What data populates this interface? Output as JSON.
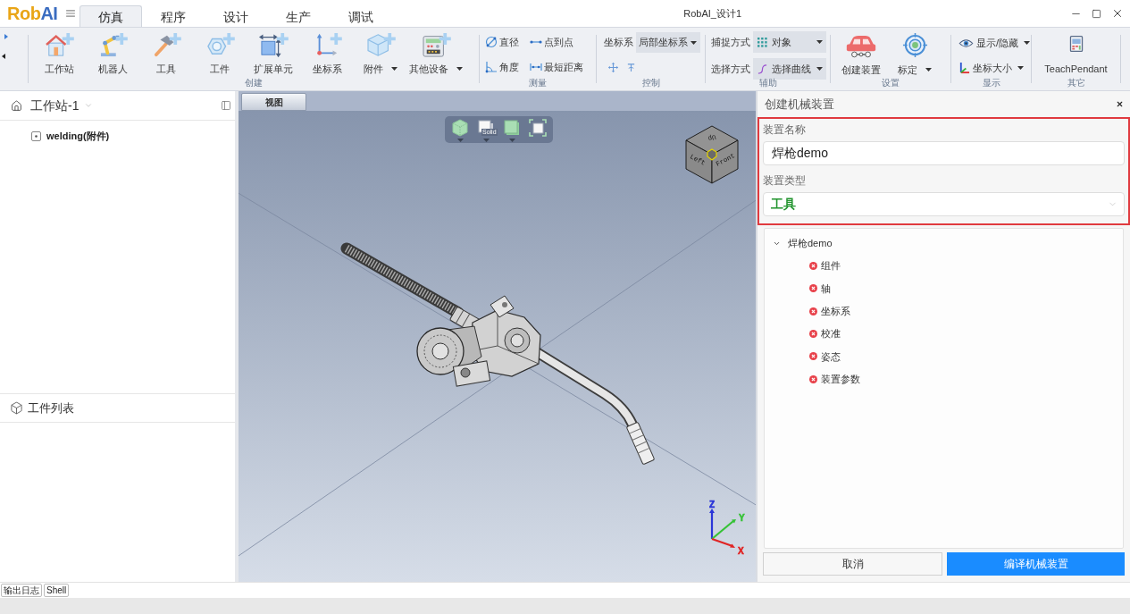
{
  "logo": {
    "text": "Rob",
    "accent": "AI"
  },
  "tabs": [
    {
      "label": "仿真",
      "selected": true
    },
    {
      "label": "程序",
      "selected": false
    },
    {
      "label": "设计",
      "selected": false
    },
    {
      "label": "生产",
      "selected": false
    },
    {
      "label": "调试",
      "selected": false
    }
  ],
  "window": {
    "title": "RobAI_设计1"
  },
  "ribbon": {
    "groups": [
      {
        "kind": "large",
        "label": "创建",
        "items": [
          {
            "label": "工作站",
            "dropdown": false
          },
          {
            "label": "机器人",
            "dropdown": false
          },
          {
            "label": "工具",
            "dropdown": false
          },
          {
            "label": "工件",
            "dropdown": false
          },
          {
            "label": "扩展单元",
            "dropdown": false
          },
          {
            "label": "坐标系",
            "dropdown": false
          },
          {
            "label": "附件",
            "dropdown": true
          },
          {
            "label": "其他设备",
            "dropdown": true
          }
        ]
      },
      {
        "kind": "grid",
        "label": "测量",
        "items": [
          {
            "label": "直径"
          },
          {
            "label": "点到点"
          },
          {
            "label": "角度"
          },
          {
            "label": "最短距离"
          }
        ]
      },
      {
        "kind": "control",
        "label": "控制",
        "fields": [
          {
            "label": "坐标系",
            "value": "局部坐标系"
          }
        ]
      },
      {
        "kind": "form",
        "label": "辅助",
        "fields": [
          {
            "label": "捕捉方式",
            "value": "对象"
          },
          {
            "label": "选择方式",
            "value": "选择曲线"
          }
        ]
      },
      {
        "kind": "large",
        "label": "设置",
        "items": [
          {
            "label": "创建装置",
            "dropdown": false
          },
          {
            "label": "标定",
            "dropdown": true
          }
        ]
      },
      {
        "kind": "list",
        "label": "显示",
        "items": [
          {
            "label": "显示/隐藏",
            "dropdown": true
          },
          {
            "label": "坐标大小",
            "dropdown": true
          }
        ]
      },
      {
        "kind": "large",
        "label": "其它",
        "items": [
          {
            "label": "TeachPendant",
            "dropdown": false
          }
        ]
      }
    ]
  },
  "workstation_panel": {
    "title": "工作站-1",
    "items": [
      {
        "label": "welding(附件)"
      }
    ]
  },
  "workpiece_panel": {
    "title": "工件列表"
  },
  "viewport": {
    "tab": "视图",
    "view_toolbar": [
      {
        "kind": "shaded",
        "dropdown": true
      },
      {
        "kind": "solid",
        "label": "Solid",
        "dropdown": true
      },
      {
        "kind": "box",
        "dropdown": true
      },
      {
        "kind": "fit",
        "dropdown": false
      }
    ],
    "view_cube": {
      "faces": [
        "Up",
        "Left",
        "Front"
      ]
    },
    "axes": [
      {
        "label": "Z",
        "color": "#2a35d8"
      },
      {
        "label": "Y",
        "color": "#36c236"
      },
      {
        "label": "X",
        "color": "#e02424"
      }
    ]
  },
  "device_panel": {
    "title": "创建机械装置",
    "form": {
      "highlighted": true,
      "fields": [
        {
          "kind": "text",
          "label": "装置名称",
          "value": "焊枪demo"
        },
        {
          "kind": "select",
          "label": "装置类型",
          "value": "工具"
        }
      ]
    },
    "tree": {
      "label": "焊枪demo",
      "expanded": true,
      "children": [
        {
          "label": "组件",
          "valid": false
        },
        {
          "label": "轴",
          "valid": false
        },
        {
          "label": "坐标系",
          "valid": false
        },
        {
          "label": "校准",
          "valid": false
        },
        {
          "label": "姿态",
          "valid": false
        },
        {
          "label": "装置参数",
          "valid": false
        }
      ]
    },
    "buttons": [
      {
        "label": "取消",
        "kind": "secondary"
      },
      {
        "label": "编译机械装置",
        "kind": "primary"
      }
    ]
  },
  "bottom_tabs": [
    {
      "label": "输出日志"
    },
    {
      "label": "Shell"
    }
  ]
}
